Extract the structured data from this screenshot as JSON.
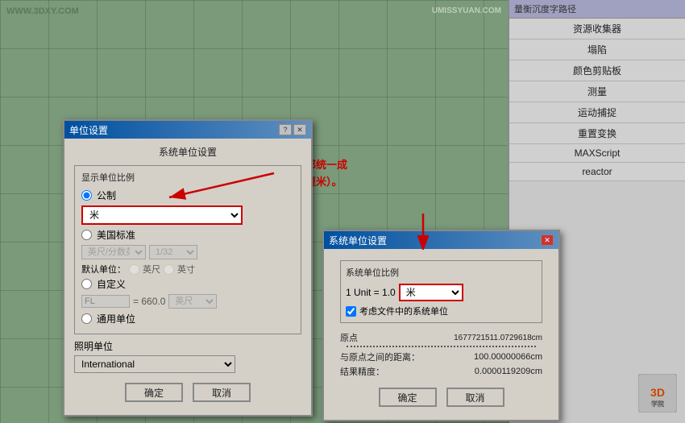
{
  "watermark": {
    "top_left": "WWW.3DXY.COM",
    "top_right": "UMISSYUAN.COM"
  },
  "annotation": {
    "line1": "把单位都统一成",
    "line2": "米（或厘米）。"
  },
  "right_panel": {
    "header": "量衡沉度字路径",
    "items": [
      "资源收集器",
      "塌陷",
      "颜色剪贴板",
      "测量",
      "运动捕捉",
      "重置变换",
      "MAXScript",
      "reactor"
    ]
  },
  "dialog_unit": {
    "title": "单位设置",
    "section_title": "系统单位设置",
    "display_label": "显示单位比例",
    "radio_metric": "公制",
    "metric_value": "米",
    "radio_us": "美国标准",
    "us_unit1": "英尺/分数英寸",
    "us_unit2": "1/32",
    "default_label": "默认单位：",
    "radio_feet": "英尺",
    "radio_inch": "英寸",
    "radio_custom": "自定义",
    "custom_unit": "FL",
    "custom_equals": "= 660.0",
    "custom_select": "英尺",
    "radio_generic": "通用单位",
    "lighting_label": "照明单位",
    "lighting_value": "International",
    "btn_ok": "确定",
    "btn_cancel": "取消",
    "btn_help": "?"
  },
  "dialog_system": {
    "title": "系统单位设置",
    "section_title": "系统单位比例",
    "unit_prefix": "1 Unit = 1.0",
    "unit_value": "米",
    "checkbox_label": "考虑文件中的系统单位",
    "origin_label": "原点",
    "origin_value": "1677721511.0729618cm",
    "distance_label": "与原点之间的距离：",
    "distance_value": "100.00000066cm",
    "precision_label": "结果精度：",
    "precision_value": "0.0000119209cm",
    "btn_ok": "确定",
    "btn_cancel": "取消"
  }
}
